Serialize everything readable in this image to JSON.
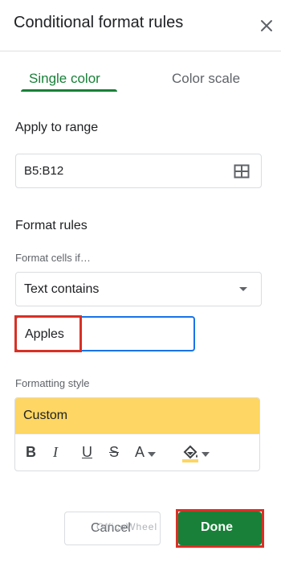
{
  "dialog": {
    "title": "Conditional format rules",
    "close_icon": "close-icon"
  },
  "tabs": [
    {
      "label": "Single color",
      "active": true
    },
    {
      "label": "Color scale",
      "active": false
    }
  ],
  "apply_range": {
    "heading": "Apply to range",
    "value": "B5:B12",
    "icon": "grid-select-icon"
  },
  "format_rules": {
    "heading": "Format rules",
    "condition_label": "Format cells if…",
    "condition_value": "Text contains",
    "value_input": "Apples"
  },
  "formatting_style": {
    "label": "Formatting style",
    "preset": "Custom",
    "preview_color": "#fdd663",
    "tools": {
      "bold": "B",
      "italic": "I",
      "underline": "U",
      "strikethrough": "S",
      "text_color": "A"
    }
  },
  "footer": {
    "cancel_label": "Cancel",
    "done_label": "Done"
  },
  "watermark": "OfficeWheel",
  "colors": {
    "accent_green": "#188038",
    "focus_blue": "#1a73e8",
    "highlight_red": "#d93025"
  }
}
